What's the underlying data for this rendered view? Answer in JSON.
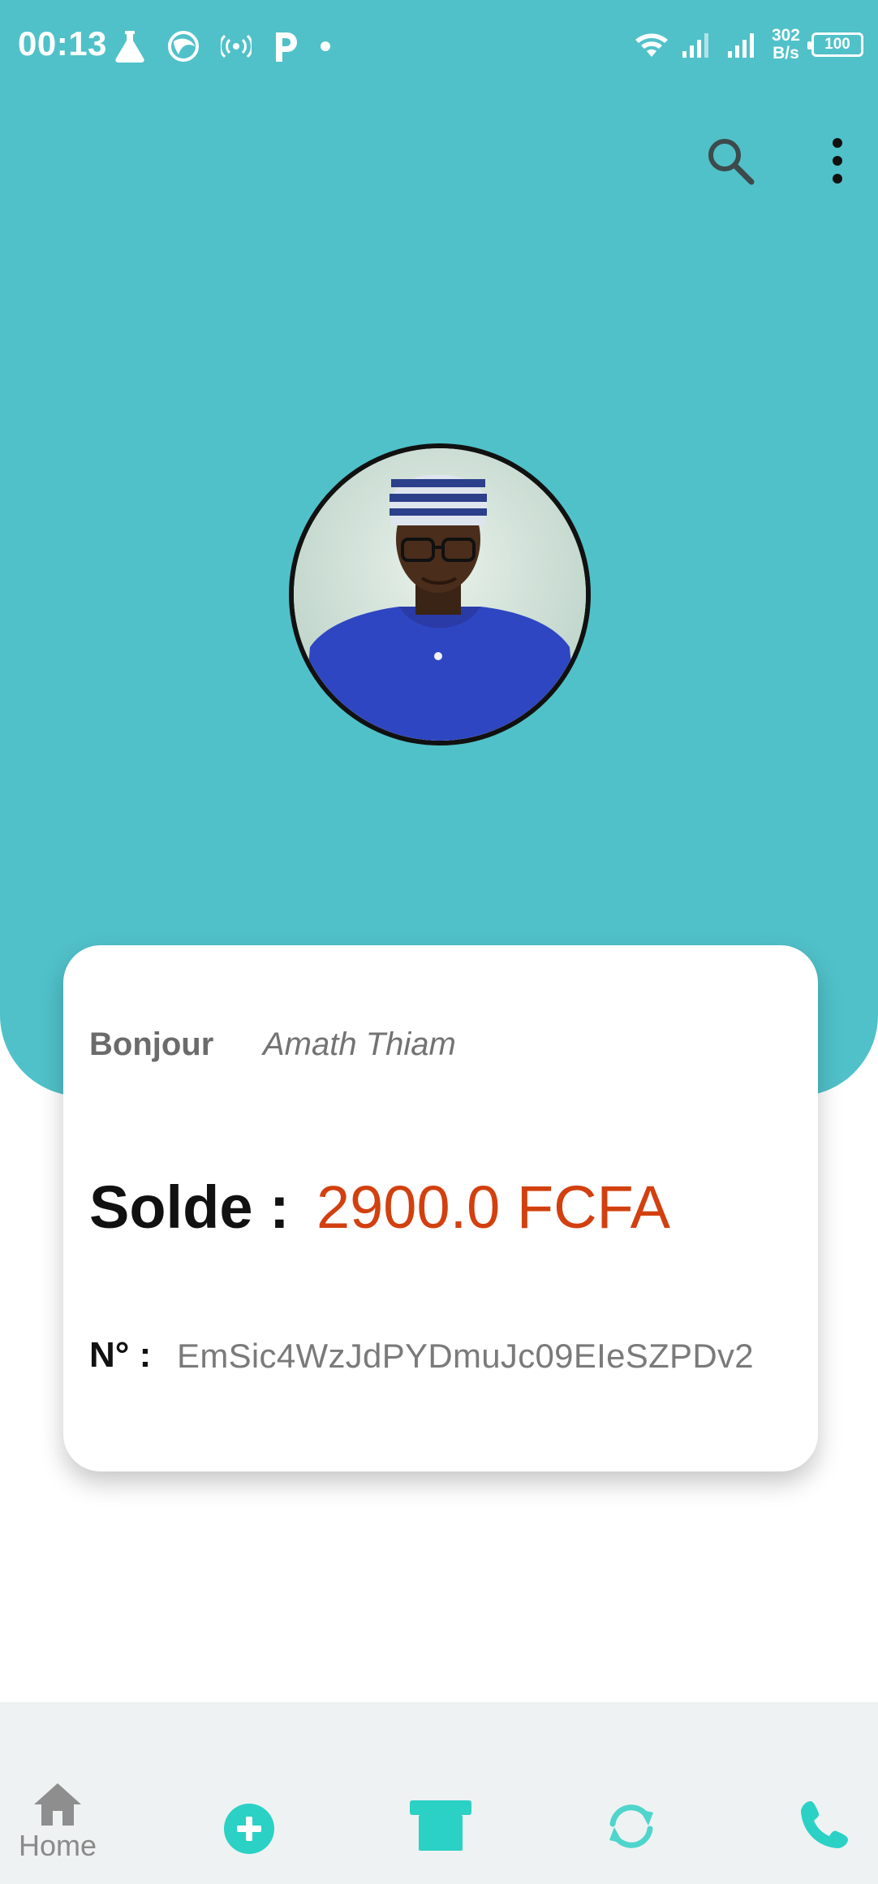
{
  "status_bar": {
    "time": "00:13",
    "network_speed_value": "302",
    "network_speed_unit": "B/s",
    "battery_level": "100",
    "left_icons": [
      "flask-icon",
      "bird-icon",
      "hotspot-icon",
      "parking-p-icon",
      "dot-icon"
    ],
    "right_icons": [
      "wifi-icon",
      "signal-bars-icon",
      "signal-bars-icon",
      "battery-icon"
    ]
  },
  "app_bar": {
    "icons": [
      "search-icon",
      "more-vertical-icon"
    ]
  },
  "profile": {
    "avatar": "profile-photo"
  },
  "card": {
    "greeting_label": "Bonjour",
    "user_name": "Amath Thiam",
    "balance_label": "Solde :",
    "balance_value": "2900.0 FCFA",
    "number_label": "N° :",
    "number_value": "EmSic4WzJdPYDmuJc09EIeSZPDv2"
  },
  "bottom_nav": {
    "items": [
      {
        "icon": "home-icon",
        "label": "Home"
      },
      {
        "icon": "add-circle-icon",
        "label": ""
      },
      {
        "icon": "shop-icon",
        "label": ""
      },
      {
        "icon": "sync-icon",
        "label": ""
      },
      {
        "icon": "phone-icon",
        "label": ""
      }
    ]
  },
  "colors": {
    "header_teal": "#50c1c9",
    "accent_teal": "#2bd1c5",
    "balance_orange": "#d2400f",
    "nav_background": "#eff2f2"
  }
}
